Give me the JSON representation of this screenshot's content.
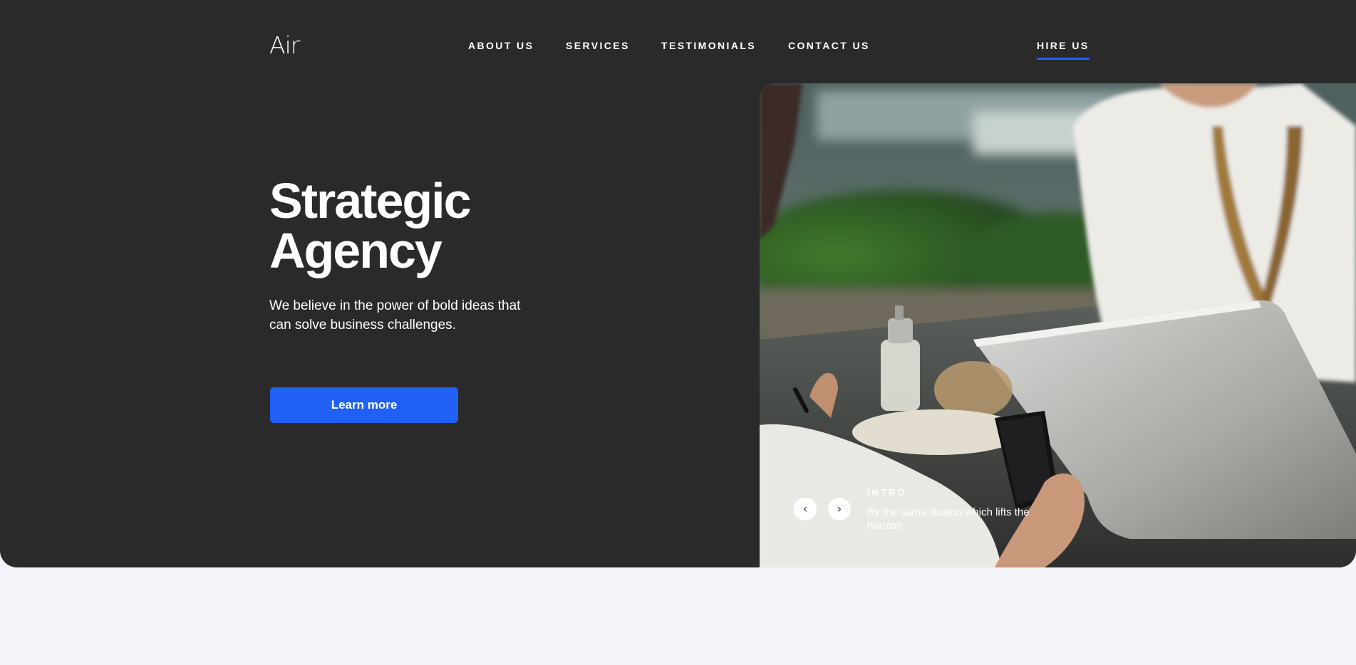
{
  "header": {
    "logo": "Air",
    "nav": [
      {
        "label": "ABOUT US"
      },
      {
        "label": "SERVICES"
      },
      {
        "label": "TESTIMONIALS"
      },
      {
        "label": "CONTACT US"
      }
    ],
    "hire_label": "HIRE US"
  },
  "hero": {
    "title_line1": "Strategic",
    "title_line2": "Agency",
    "subtitle_line1": "We believe in the power of bold ideas that",
    "subtitle_line2": "can solve business challenges.",
    "cta_label": "Learn more"
  },
  "slider": {
    "prev_icon": "chevron-left-icon",
    "next_icon": "chevron-right-icon",
    "caption_label": "INTRO",
    "caption_line1": "By the same illusion which lifts the",
    "caption_line2": "horizon."
  },
  "colors": {
    "hero_background": "#2a2a2a",
    "accent": "#2160f5",
    "page_background": "#f2f4f9"
  }
}
